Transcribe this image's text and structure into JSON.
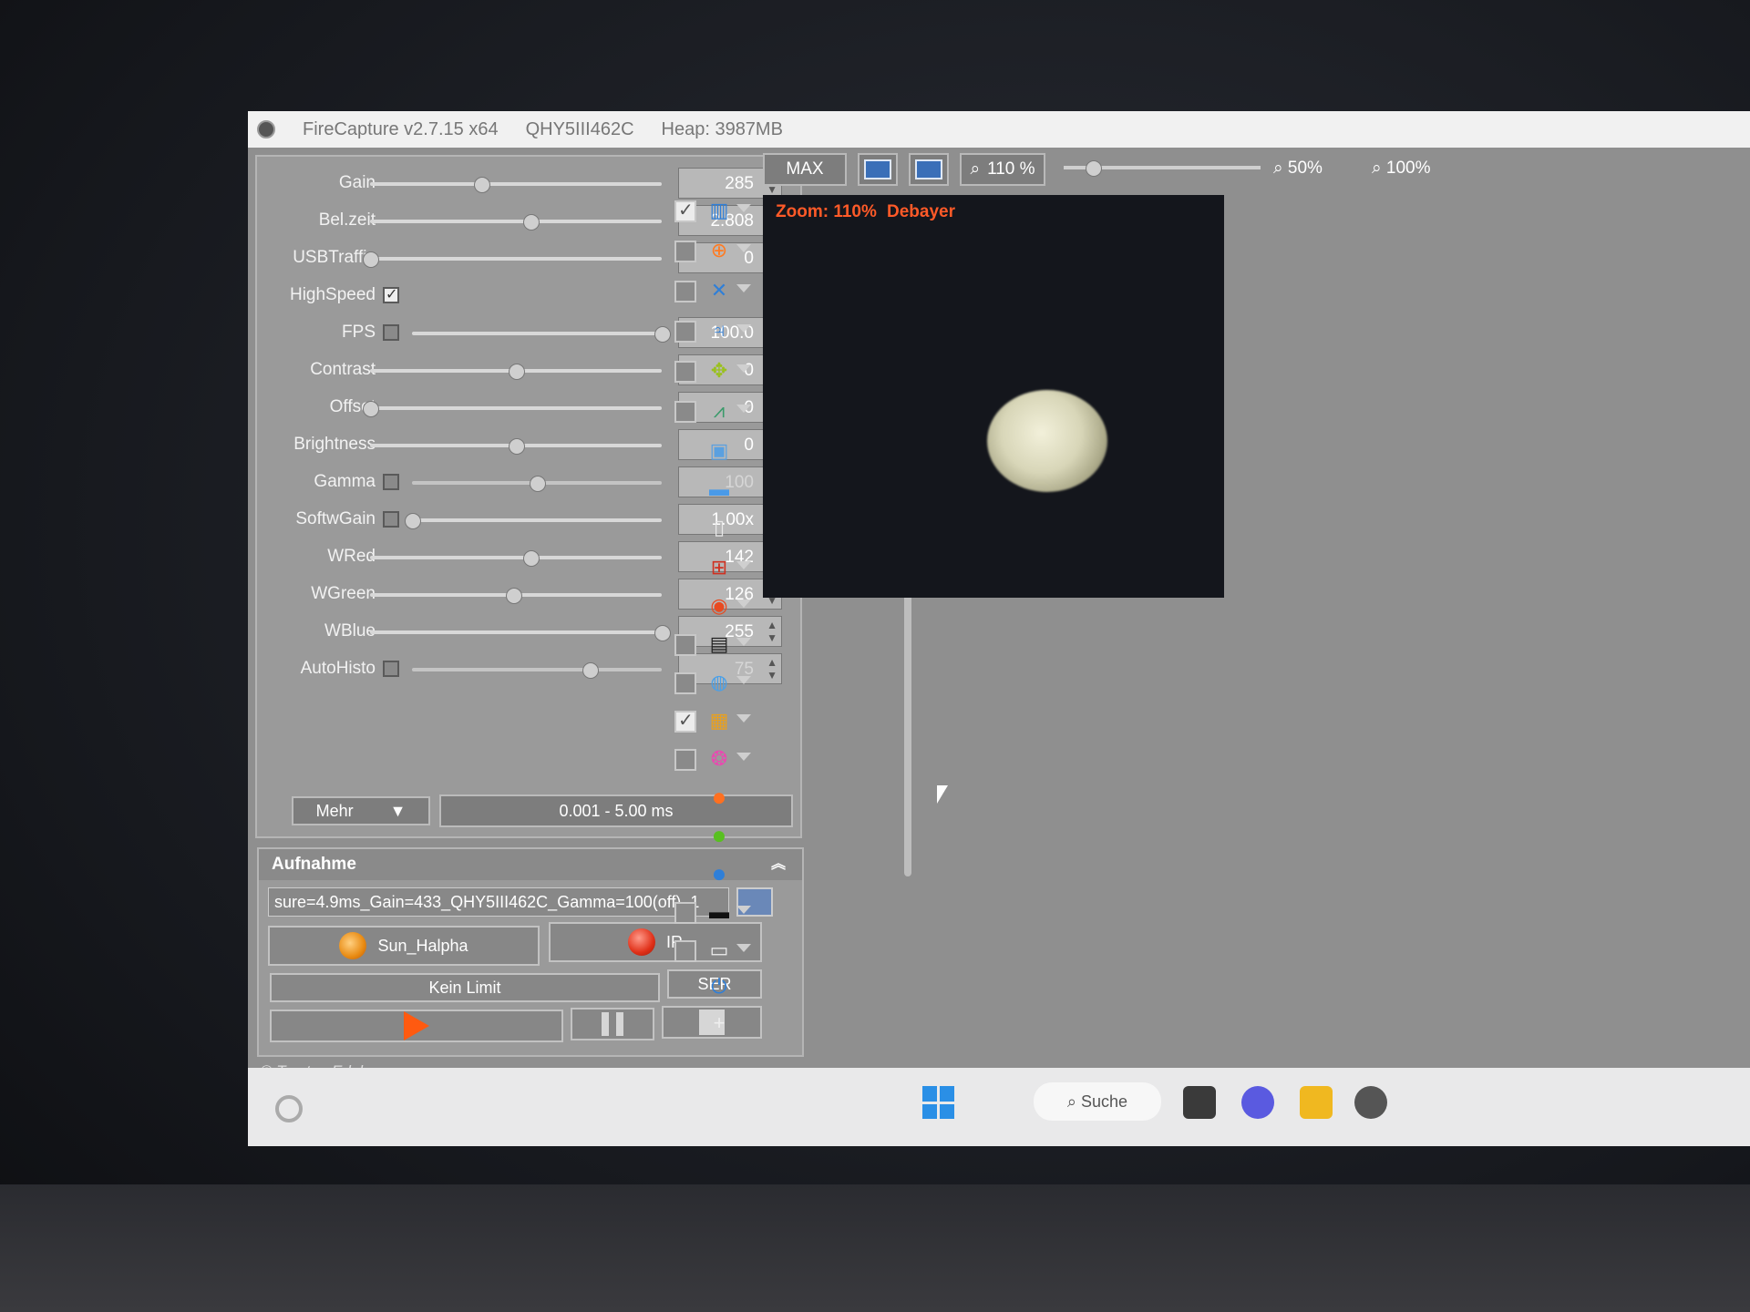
{
  "window": {
    "app_title": "FireCapture v2.7.15 x64",
    "camera": "QHY5III462C",
    "heap": "Heap: 3987MB"
  },
  "controls": [
    {
      "label": "Gain",
      "value": "285",
      "slider_pos": 0.38,
      "has_checkbox": false
    },
    {
      "label": "Bel.zeit",
      "value": "2.808",
      "slider_pos": 0.55,
      "has_checkbox": false
    },
    {
      "label": "USBTraffic",
      "value": "0",
      "slider_pos": 0.0,
      "has_checkbox": false
    },
    {
      "label": "HighSpeed",
      "checked": true
    },
    {
      "label": "FPS",
      "value": "100.0",
      "slider_pos": 1.0,
      "has_checkbox": true,
      "checked": false
    },
    {
      "label": "Contrast",
      "value": "0",
      "slider_pos": 0.5,
      "has_checkbox": false
    },
    {
      "label": "Offset",
      "value": "0",
      "slider_pos": 0.0,
      "has_checkbox": false
    },
    {
      "label": "Brightness",
      "value": "0",
      "slider_pos": 0.5,
      "has_checkbox": false
    },
    {
      "label": "Gamma",
      "value": "100",
      "slider_pos": 0.5,
      "has_checkbox": true,
      "checked": false,
      "disabled": true
    },
    {
      "label": "SoftwGain",
      "value": "1.00x",
      "slider_pos": 0.0,
      "has_checkbox": true,
      "checked": false
    },
    {
      "label": "WRed",
      "value": "142",
      "slider_pos": 0.55,
      "has_checkbox": false
    },
    {
      "label": "WGreen",
      "value": "126",
      "slider_pos": 0.49,
      "has_checkbox": false
    },
    {
      "label": "WBlue",
      "value": "255",
      "slider_pos": 1.0,
      "has_checkbox": false
    },
    {
      "label": "AutoHisto",
      "value": "75",
      "slider_pos": 0.71,
      "has_checkbox": true,
      "checked": false,
      "disabled": true
    }
  ],
  "more_button": "Mehr",
  "exposure_range": "0.001 - 5.00 ms",
  "capture": {
    "title": "Aufnahme",
    "filename": "sure=4.9ms_Gain=433_QHY5III462C_Gamma=100(off)_1",
    "profile_label": "Sun_Halpha",
    "filter_label": "IR",
    "limit_label": "Kein Limit",
    "format_label": "SER"
  },
  "copyright": "© Torsten Edelmann",
  "toolbar": {
    "max_label": "MAX",
    "zoom_label": "110 %",
    "zoom_50": "50%",
    "zoom_100": "100%"
  },
  "preview": {
    "zoom_text": "Zoom: 110%",
    "debayer_text": "Debayer"
  },
  "taskbar": {
    "search_label": "Suche"
  },
  "colors": {
    "accent_orange": "#ff5a28",
    "panel_bg": "#9a9a9a",
    "preview_bg": "#14161c"
  }
}
